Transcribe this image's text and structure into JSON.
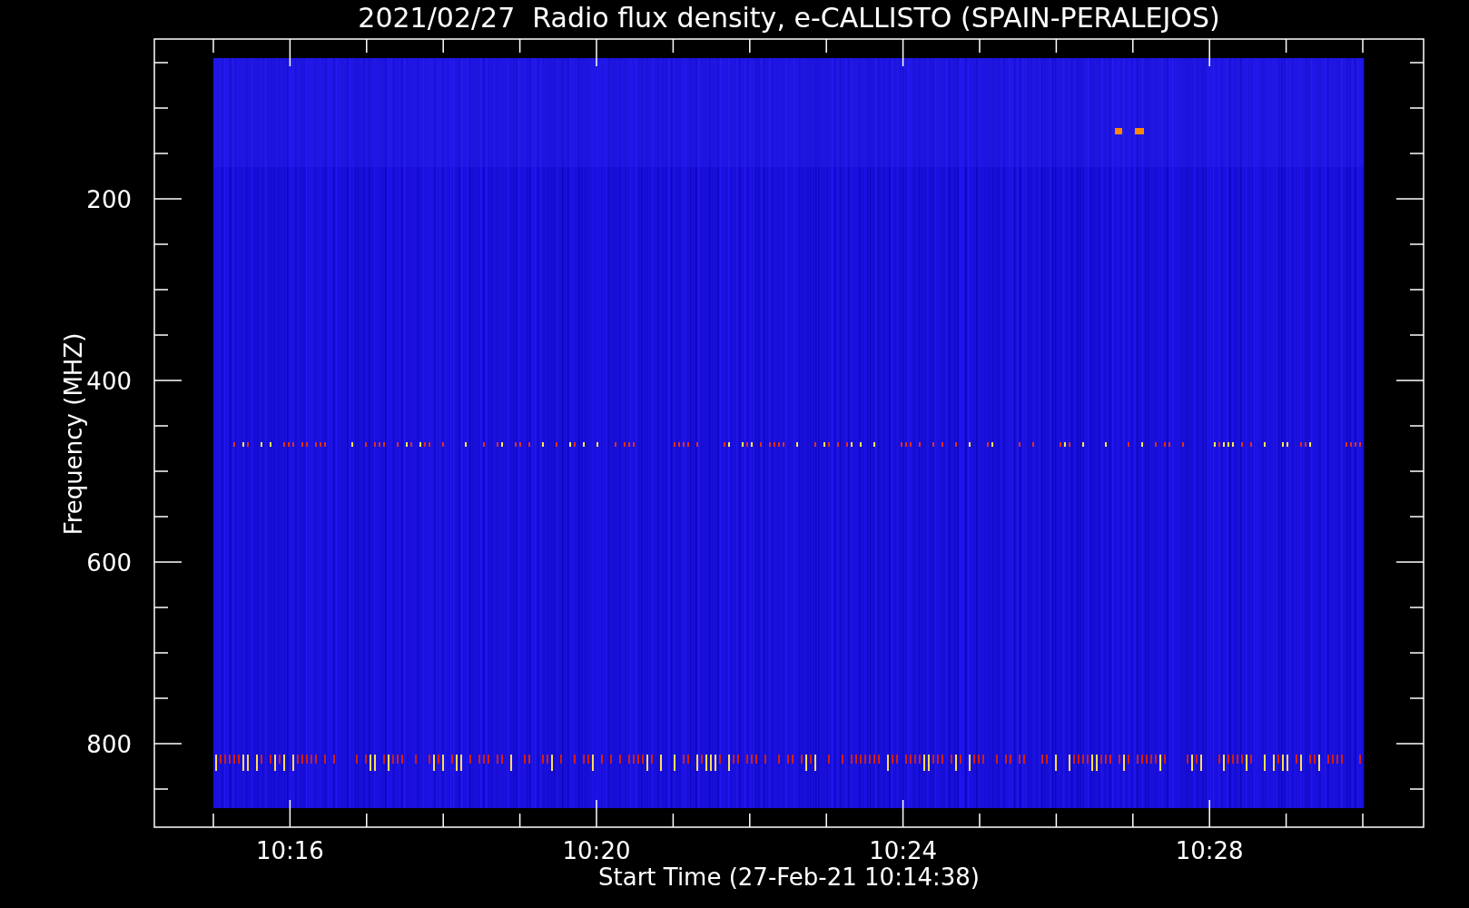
{
  "title": "2021/02/27  Radio flux density, e-CALLISTO (SPAIN-PERALEJOS)",
  "y_axis": {
    "label": "Frequency (MHZ)",
    "tick_labels": [
      "200",
      "400",
      "600",
      "800"
    ]
  },
  "x_axis": {
    "label": "Start Time (27-Feb-21 10:14:38)",
    "tick_labels": [
      "10:16",
      "10:20",
      "10:24",
      "10:28"
    ]
  }
}
